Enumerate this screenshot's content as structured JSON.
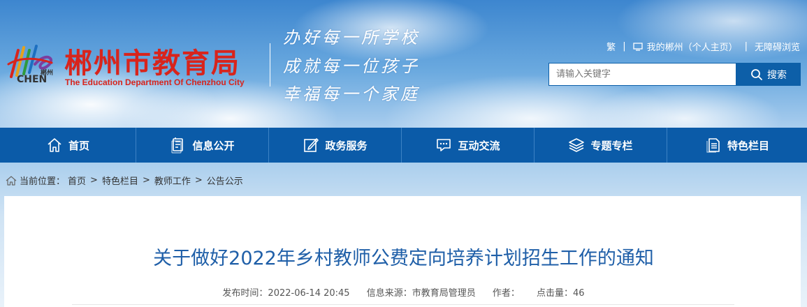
{
  "header": {
    "logo_small_text": "郴州",
    "logo_chen_text": "CHEN",
    "site_title": "郴州市教育局",
    "site_subtitle": "The Education Department Of Chenzhou City",
    "slogans": [
      "办好每一所学校",
      "成就每一位孩子",
      "幸福每一个家庭"
    ]
  },
  "toplinks": {
    "traditional": "繁",
    "my_chenzhou": "我的郴州（个人主页）",
    "accessible": "无障碍浏览",
    "separator": "|"
  },
  "search": {
    "placeholder": "请输入关键字",
    "button_label": "搜索"
  },
  "nav": {
    "items": [
      {
        "label": "首页",
        "icon": "home-icon"
      },
      {
        "label": "信息公开",
        "icon": "document-icon"
      },
      {
        "label": "政务服务",
        "icon": "edit-icon"
      },
      {
        "label": "互动交流",
        "icon": "chat-icon"
      },
      {
        "label": "专题专栏",
        "icon": "layers-icon"
      },
      {
        "label": "特色栏目",
        "icon": "list-doc-icon"
      }
    ]
  },
  "breadcrumb": {
    "prefix": "当前位置：",
    "items": [
      "首页",
      "特色栏目",
      "教师工作",
      "公告公示"
    ],
    "separator": ">"
  },
  "article": {
    "title": "关于做好2022年乡村教师公费定向培养计划招生工作的通知",
    "publish_time": "发布时间：2022-06-14 20:45",
    "source": "信息来源：市教育局管理员",
    "author": "作者：",
    "views": "点击量：46"
  },
  "colors": {
    "brand_red": "#d8241c",
    "nav_blue": "#0b5ba8",
    "title_blue": "#1f5fa8"
  }
}
